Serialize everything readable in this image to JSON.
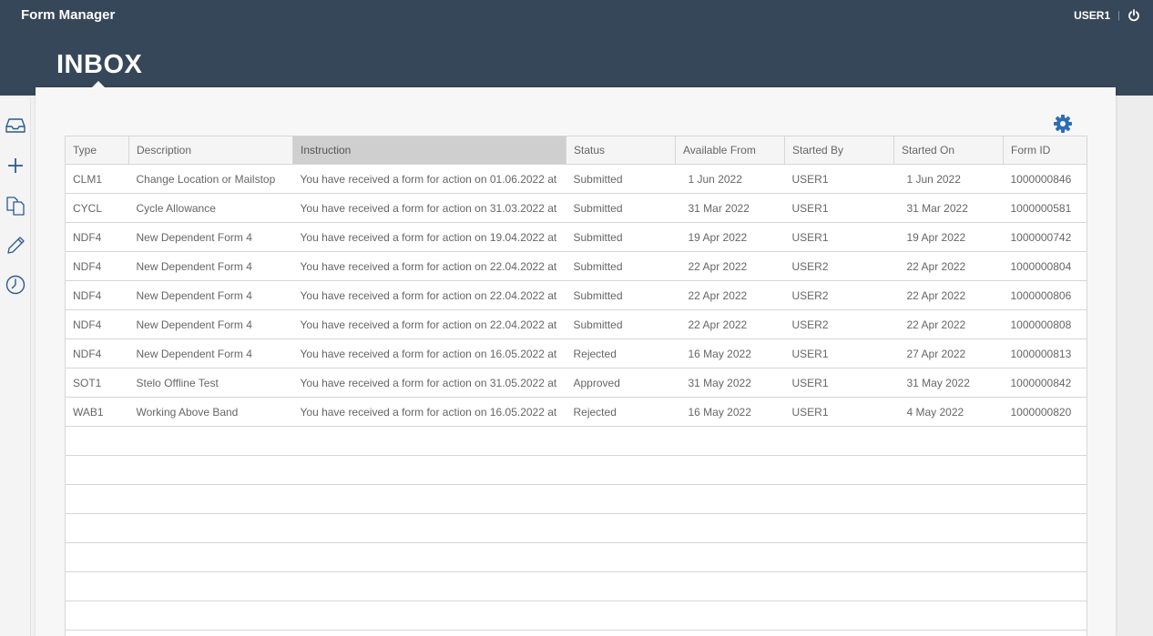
{
  "app": {
    "title": "Form Manager",
    "user": "USER1",
    "separator": "|",
    "page_title": "INBOX"
  },
  "colors": {
    "header_bg": "#36475a",
    "accent_gear": "#2c6eb5",
    "icon_color": "#2c5a8f"
  },
  "sidebar": {
    "items": [
      {
        "icon": "inbox-icon"
      },
      {
        "icon": "plus-icon"
      },
      {
        "icon": "copy-icon"
      },
      {
        "icon": "pencil-icon"
      },
      {
        "icon": "clock-icon"
      }
    ]
  },
  "table": {
    "columns": [
      "Type",
      "Description",
      "Instruction",
      "Status",
      "Available From",
      "Started By",
      "Started On",
      "Form ID"
    ],
    "sorted_column": "Instruction",
    "rows": [
      [
        "CLM1",
        "Change Location or Mailstop",
        "You have received a form for action on 01.06.2022 at",
        "Submitted",
        "1 Jun 2022",
        "USER1",
        "1 Jun 2022",
        "1000000846"
      ],
      [
        "CYCL",
        "Cycle Allowance",
        "You have received a form for action on 31.03.2022 at",
        "Submitted",
        "31 Mar 2022",
        "USER1",
        "31 Mar 2022",
        "1000000581"
      ],
      [
        "NDF4",
        "New Dependent Form 4",
        "You have received a form for action on 19.04.2022 at",
        "Submitted",
        "19 Apr 2022",
        "USER1",
        "19 Apr 2022",
        "1000000742"
      ],
      [
        "NDF4",
        "New Dependent Form 4",
        "You have received a form for action on 22.04.2022 at",
        "Submitted",
        "22 Apr 2022",
        "USER2",
        "22 Apr 2022",
        "1000000804"
      ],
      [
        "NDF4",
        "New Dependent Form 4",
        "You have received a form for action on 22.04.2022 at",
        "Submitted",
        "22 Apr 2022",
        "USER2",
        "22 Apr 2022",
        "1000000806"
      ],
      [
        "NDF4",
        "New Dependent Form 4",
        "You have received a form for action on 22.04.2022 at",
        "Submitted",
        "22 Apr 2022",
        "USER2",
        "22 Apr 2022",
        "1000000808"
      ],
      [
        "NDF4",
        "New Dependent Form 4",
        "You have received a form for action on 16.05.2022 at",
        "Rejected",
        "16 May 2022",
        "USER1",
        "27 Apr 2022",
        "1000000813"
      ],
      [
        "SOT1",
        "Stelo Offline Test",
        "You have received a form for action on 31.05.2022 at",
        "Approved",
        "31 May 2022",
        "USER1",
        "31 May 2022",
        "1000000842"
      ],
      [
        "WAB1",
        "Working Above Band",
        "You have received a form for action on 16.05.2022 at",
        "Rejected",
        "16 May 2022",
        "USER1",
        "4 May 2022",
        "1000000820"
      ]
    ]
  }
}
